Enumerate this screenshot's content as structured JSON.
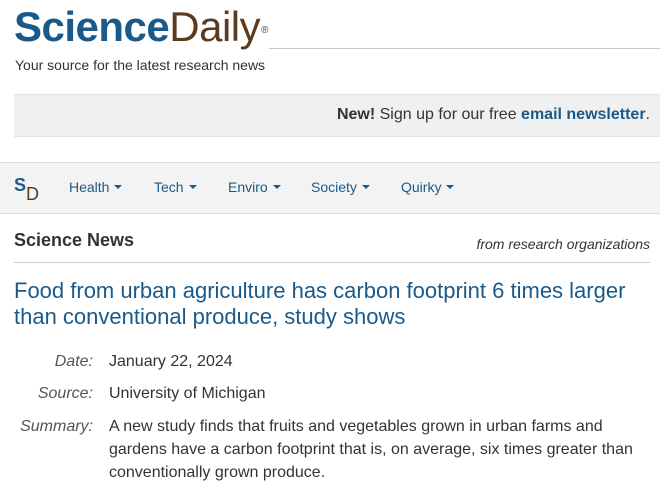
{
  "masthead": {
    "logo_science": "Science",
    "logo_daily": "Daily",
    "logo_reg": "®",
    "tagline": "Your source for the latest research news"
  },
  "promo": {
    "new_label": "New!",
    "text": " Sign up for our free ",
    "link_text": "email newsletter",
    "end": "."
  },
  "nav": {
    "logo_s": "S",
    "logo_d": "D",
    "items": [
      {
        "label": "Health"
      },
      {
        "label": "Tech"
      },
      {
        "label": "Enviro"
      },
      {
        "label": "Society"
      },
      {
        "label": "Quirky"
      }
    ]
  },
  "section": {
    "title": "Science News",
    "subtitle": "from research organizations"
  },
  "article": {
    "headline": "Food from urban agriculture has carbon footprint 6 times larger than conventional produce, study shows",
    "date_label": "Date:",
    "date_value": "January 22, 2024",
    "source_label": "Source:",
    "source_value": "University of Michigan",
    "summary_label": "Summary:",
    "summary_value": "A new study finds that fruits and vegetables grown in urban farms and gardens have a carbon footprint that is, on average, six times greater than conventionally grown produce."
  },
  "colors": {
    "brand_blue": "#1a5a8a",
    "brand_brown": "#5b3a1e"
  }
}
